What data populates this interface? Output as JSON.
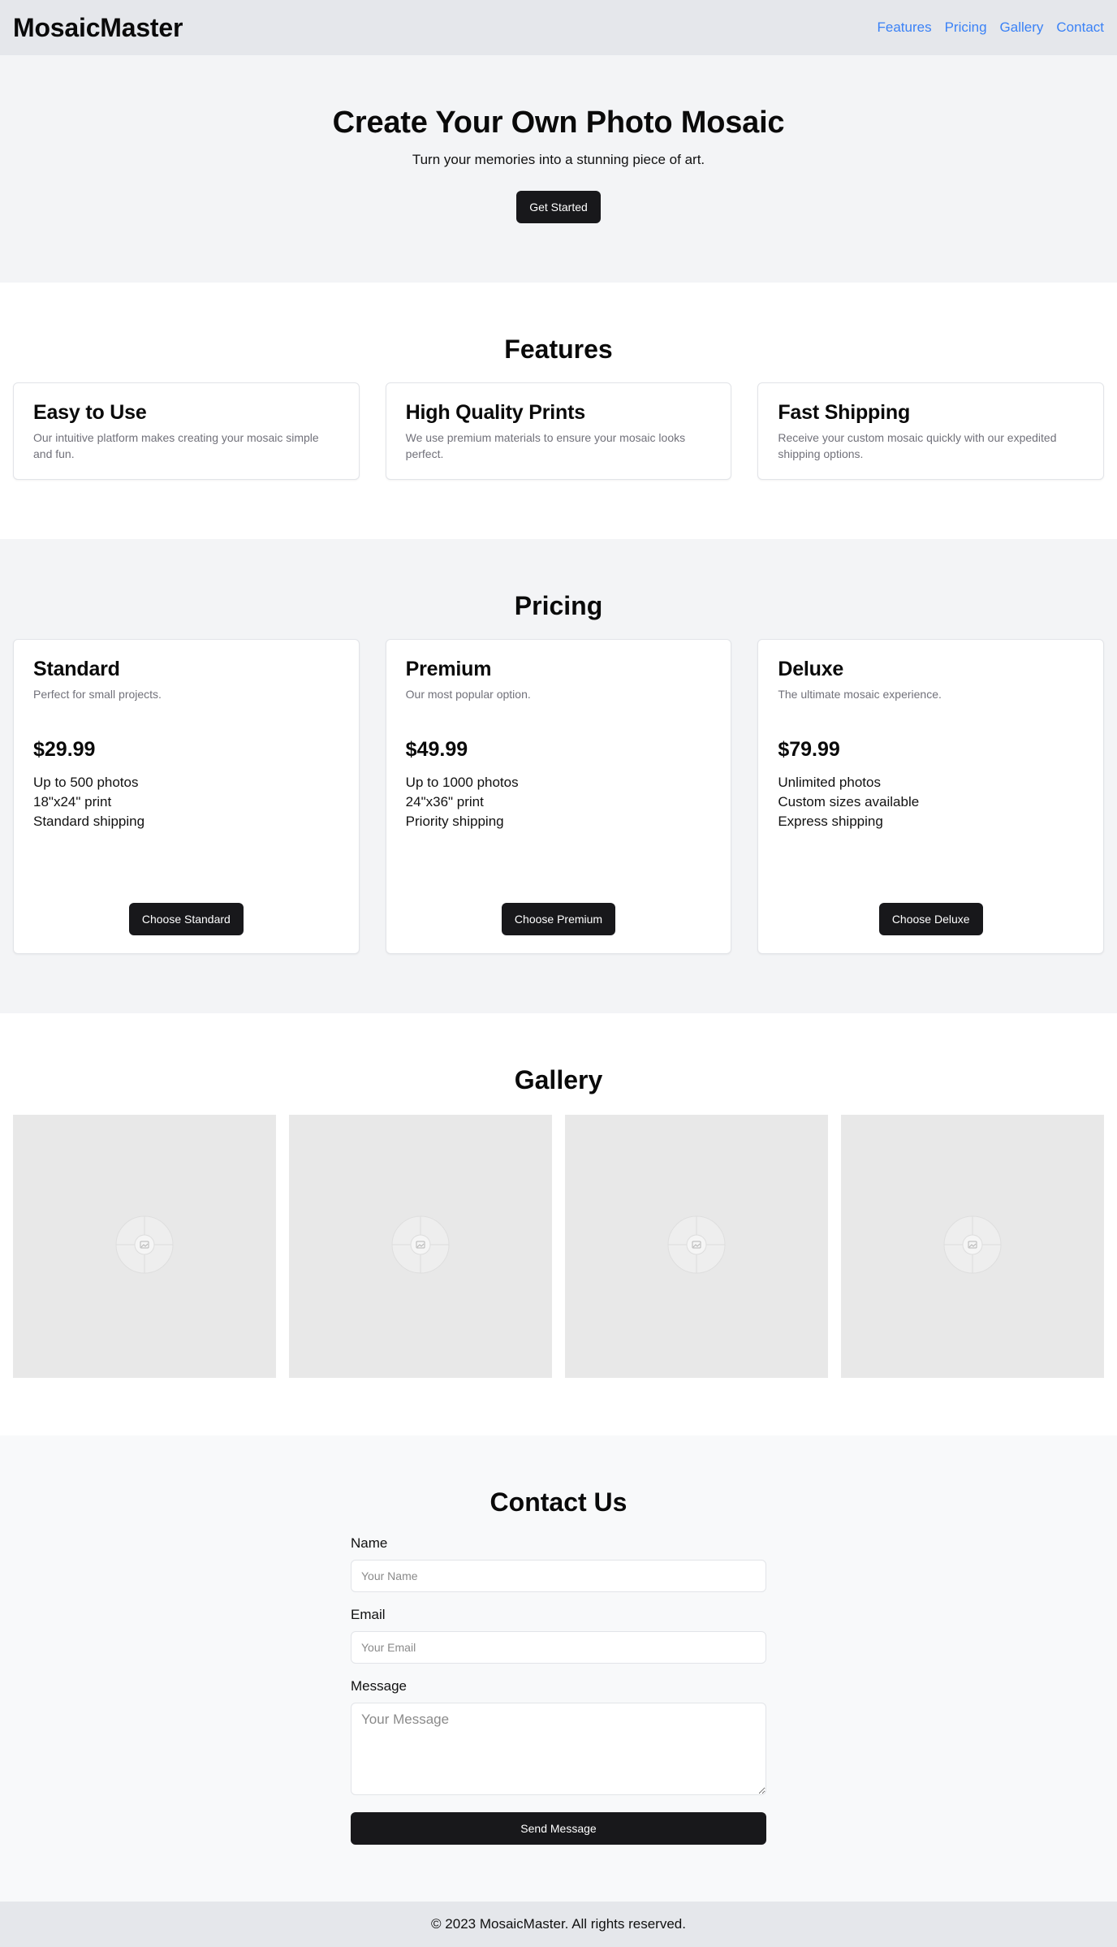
{
  "colors": {
    "header_bg": "#e5e7eb",
    "nav_link": "#3b82f6",
    "button_bg": "#18181b",
    "hero_bg": "#f3f4f6",
    "muted_text": "#71717a"
  },
  "header": {
    "brand": "MosaicMaster",
    "nav": [
      "Features",
      "Pricing",
      "Gallery",
      "Contact"
    ]
  },
  "hero": {
    "title": "Create Your Own Photo Mosaic",
    "subtitle": "Turn your memories into a stunning piece of art.",
    "cta": "Get Started"
  },
  "features": {
    "title": "Features",
    "items": [
      {
        "title": "Easy to Use",
        "description": "Our intuitive platform makes creating your mosaic simple and fun."
      },
      {
        "title": "High Quality Prints",
        "description": "We use premium materials to ensure your mosaic looks perfect."
      },
      {
        "title": "Fast Shipping",
        "description": "Receive your custom mosaic quickly with our expedited shipping options."
      }
    ]
  },
  "pricing": {
    "title": "Pricing",
    "plans": [
      {
        "name": "Standard",
        "tagline": "Perfect for small projects.",
        "price": "$29.99",
        "features": [
          "Up to 500 photos",
          "18\"x24\" print",
          "Standard shipping"
        ],
        "button": "Choose Standard"
      },
      {
        "name": "Premium",
        "tagline": "Our most popular option.",
        "price": "$49.99",
        "features": [
          "Up to 1000 photos",
          "24\"x36\" print",
          "Priority shipping"
        ],
        "button": "Choose Premium"
      },
      {
        "name": "Deluxe",
        "tagline": "The ultimate mosaic experience.",
        "price": "$79.99",
        "features": [
          "Unlimited photos",
          "Custom sizes available",
          "Express shipping"
        ],
        "button": "Choose Deluxe"
      }
    ]
  },
  "gallery": {
    "title": "Gallery",
    "images": [
      {
        "icon": "image-placeholder-icon"
      },
      {
        "icon": "image-placeholder-icon"
      },
      {
        "icon": "image-placeholder-icon"
      },
      {
        "icon": "image-placeholder-icon"
      }
    ]
  },
  "contact": {
    "title": "Contact Us",
    "name_label": "Name",
    "name_placeholder": "Your Name",
    "email_label": "Email",
    "email_placeholder": "Your Email",
    "message_label": "Message",
    "message_placeholder": "Your Message",
    "submit": "Send Message"
  },
  "footer": {
    "text": "© 2023 MosaicMaster. All rights reserved."
  }
}
